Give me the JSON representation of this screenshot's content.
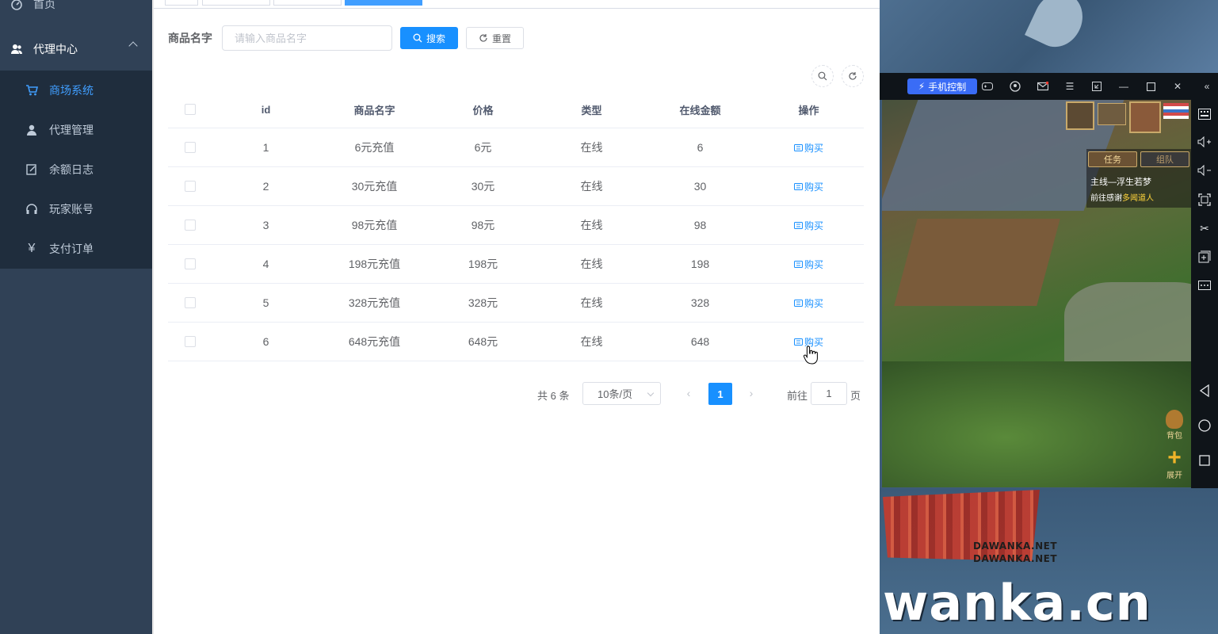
{
  "sidebar": {
    "home_label": "首页",
    "agent_center_label": "代理中心",
    "items": [
      {
        "label": "商场系统",
        "icon": "cart-icon",
        "active": true
      },
      {
        "label": "代理管理",
        "icon": "user-icon",
        "active": false
      },
      {
        "label": "余额日志",
        "icon": "edit-icon",
        "active": false
      },
      {
        "label": "玩家账号",
        "icon": "headset-icon",
        "active": false
      },
      {
        "label": "支付订单",
        "icon": "yen-icon",
        "active": false
      }
    ],
    "colors": {
      "bg": "#304156",
      "submenu_bg": "#1f2d3d",
      "active": "#409eff",
      "text": "#bfcbd9"
    }
  },
  "search": {
    "label": "商品名字",
    "placeholder": "请输入商品名字",
    "search_button": "搜索",
    "reset_button": "重置"
  },
  "table": {
    "headers": [
      "id",
      "商品名字",
      "价格",
      "类型",
      "在线金额",
      "操作"
    ],
    "rows": [
      {
        "id": "1",
        "name": "6元充值",
        "price": "6元",
        "type": "在线",
        "amount": "6",
        "action": "购买"
      },
      {
        "id": "2",
        "name": "30元充值",
        "price": "30元",
        "type": "在线",
        "amount": "30",
        "action": "购买"
      },
      {
        "id": "3",
        "name": "98元充值",
        "price": "98元",
        "type": "在线",
        "amount": "98",
        "action": "购买"
      },
      {
        "id": "4",
        "name": "198元充值",
        "price": "198元",
        "type": "在线",
        "amount": "198",
        "action": "购买"
      },
      {
        "id": "5",
        "name": "328元充值",
        "price": "328元",
        "type": "在线",
        "amount": "328",
        "action": "购买"
      },
      {
        "id": "6",
        "name": "648元充值",
        "price": "648元",
        "type": "在线",
        "amount": "648",
        "action": "购买"
      }
    ]
  },
  "pagination": {
    "total_text": "共 6 条",
    "page_size": "10条/页",
    "current_page": "1",
    "goto_label": "前往",
    "goto_value": "1",
    "page_suffix": "页",
    "accent": "#1890ff"
  },
  "emulator": {
    "control_label": "手机控制",
    "game": {
      "task_button": "任务",
      "team_button": "组队",
      "task_title": "主线—浮生若梦",
      "task_desc_prefix": "前往感谢",
      "task_desc_highlight": "多闻道人",
      "bag_label": "背包",
      "expand_label": "展开"
    }
  },
  "watermark": {
    "brand_line1": "DAWANKA.NET",
    "brand_line2": "DAWANKA.NET",
    "domain": "wanka.cn"
  }
}
